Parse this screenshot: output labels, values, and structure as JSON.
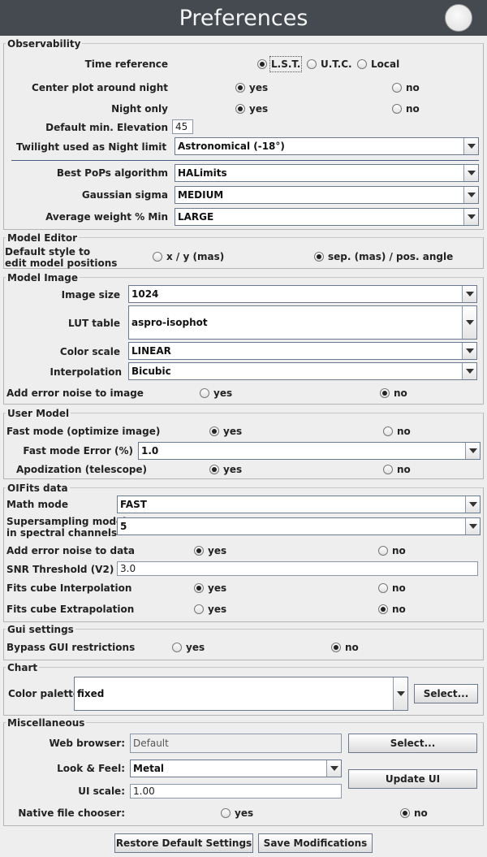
{
  "window": {
    "title": "Preferences"
  },
  "observability": {
    "title": "Observability",
    "time_ref_label": "Time reference",
    "time_ref_options": [
      "L.S.T.",
      "U.T.C.",
      "Local"
    ],
    "center_label": "Center plot around night",
    "night_only_label": "Night only",
    "yes": "yes",
    "no": "no",
    "min_elev_label": "Default min. Elevation",
    "min_elev_value": "45",
    "twilight_label": "Twilight used as Night limit",
    "twilight_value": "Astronomical (-18°)",
    "pops_label": "Best PoPs algorithm",
    "pops_value": "HALimits",
    "sigma_label": "Gaussian sigma",
    "sigma_value": "MEDIUM",
    "weight_label": "Average weight % Min",
    "weight_value": "LARGE"
  },
  "model_editor": {
    "title": "Model Editor",
    "style_label_1": "Default style to",
    "style_label_2": "edit model positions",
    "opt_xy": "x / y (mas)",
    "opt_sep": "sep. (mas) / pos. angle"
  },
  "model_image": {
    "title": "Model Image",
    "size_label": "Image size",
    "size_value": "1024",
    "lut_label": "LUT table",
    "lut_value": "aspro-isophot",
    "scale_label": "Color scale",
    "scale_value": "LINEAR",
    "interp_label": "Interpolation",
    "interp_value": "Bicubic",
    "noise_label": "Add error noise to image",
    "yes": "yes",
    "no": "no"
  },
  "user_model": {
    "title": "User Model",
    "fast_label": "Fast mode (optimize image)",
    "fast_err_label": "Fast mode Error (%)",
    "fast_err_value": "1.0",
    "apod_label": "Apodization (telescope)",
    "yes": "yes",
    "no": "no"
  },
  "oifits": {
    "title": "OIFits data",
    "math_label": "Math mode",
    "math_value": "FAST",
    "super_label_1": "Supersampling model",
    "super_label_2": "in spectral channels",
    "super_value": "5",
    "noise_label": "Add error noise to data",
    "snr_label": "SNR Threshold (V2)",
    "snr_value": "3.0",
    "cube_interp_label": "Fits cube Interpolation",
    "cube_extrap_label": "Fits cube Extrapolation",
    "yes": "yes",
    "no": "no"
  },
  "gui": {
    "title": "Gui settings",
    "bypass_label": "Bypass GUI restrictions",
    "yes": "yes",
    "no": "no"
  },
  "chart": {
    "title": "Chart",
    "palette_label": "Color palette:",
    "palette_value": "fixed",
    "select_label": "Select..."
  },
  "misc": {
    "title": "Miscellaneous",
    "browser_label": "Web browser:",
    "browser_value": "Default",
    "browser_select": "Select...",
    "laf_label": "Look & Feel:",
    "laf_value": "Metal",
    "update_ui": "Update UI",
    "ui_scale_label": "UI scale:",
    "ui_scale_value": "1.00",
    "chooser_label": "Native file chooser:",
    "yes": "yes",
    "no": "no"
  },
  "footer": {
    "restore": "Restore Default Settings",
    "save": "Save Modifications"
  }
}
